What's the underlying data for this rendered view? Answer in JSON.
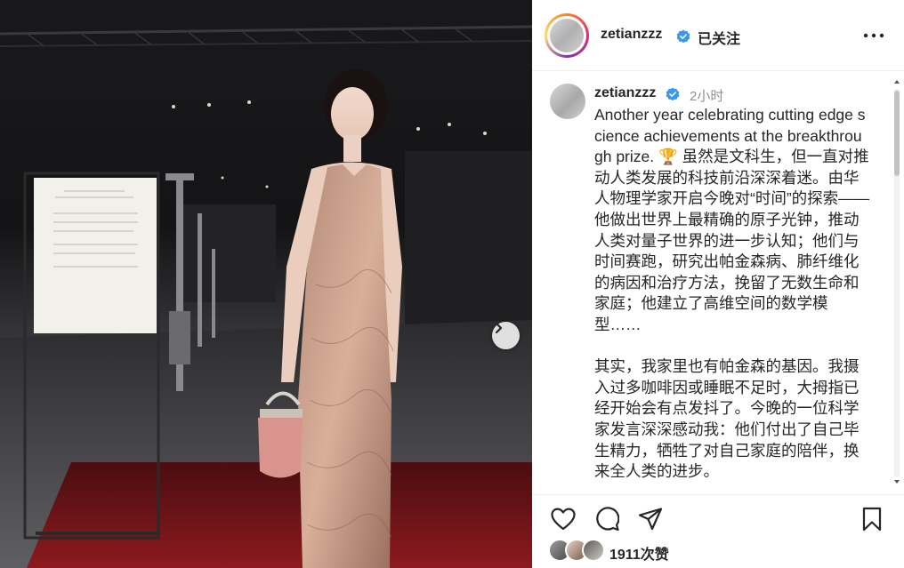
{
  "post": {
    "username": "zetianzzz",
    "follow_state": "已关注",
    "time_ago": "2小时",
    "caption_p1": "Another year celebrating cutting edge science achievements at the breakthrough prize. 🏆 虽然是文科生，但一直对推动人类发展的科技前沿深深着迷。由华人物理学家开启今晚对“时间”的探索——他做出世界上最精确的原子光钟，推动人类对量子世界的进一步认知；他们与时间赛跑，研究出帕金森病、肺纤维化的病因和治疗方法，挽留了无数生命和家庭；他建立了高维空间的数学模型……",
    "caption_p2": "其实，我家里也有帕金森的基因。我摄入过多咖啡因或睡眠不足时，大拇指已经开始会有点发抖了。今晚的一位科学家发言深深感动我：他们付出了自己毕生精力，牺牲了对自己家庭的陪伴，换来全人类的进步。",
    "likes": "1911次赞"
  },
  "icons": {
    "verified": "verified-badge-icon",
    "more": "more-options-icon",
    "like": "heart-icon",
    "comment": "comment-icon",
    "share": "paper-plane-icon",
    "save": "bookmark-icon",
    "next": "chevron-right-icon"
  },
  "colors": {
    "verified_blue": "#3897f0",
    "text": "#262626",
    "muted": "#8e8e8e",
    "carpet_red": "#7a1418"
  }
}
